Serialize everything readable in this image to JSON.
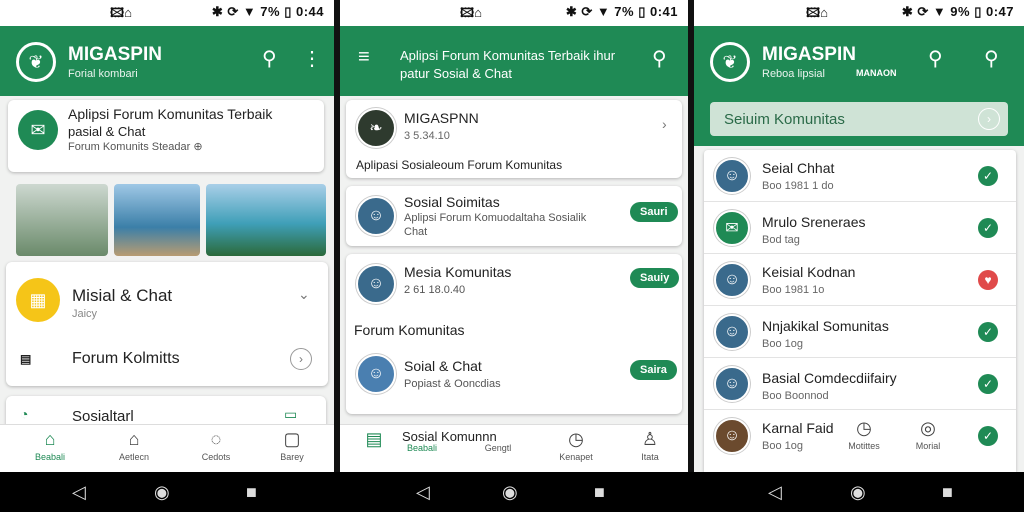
{
  "panel1": {
    "status_left": "🖾⌂",
    "status_right": "✱ ⟳ ▼ 7% ▯ 0:44",
    "brand": "MIGASPIN",
    "brand_sub": "Forial kombari",
    "feature_title": "Aplipsi Forum Komunitas Terbaik",
    "feature_line2": "pasial & Chat",
    "feature_line3": "Forum Komunits Steadar ⊕",
    "item1_title": "Misial & Chat",
    "item1_sub": "Jaicy",
    "item2_title": "Forum Kolmitts",
    "item3_title": "Sosialtarl",
    "nav": [
      "Beabali",
      "Aetlecn",
      "Cedots",
      "Barey"
    ]
  },
  "panel2": {
    "status_left": "🖾⌂",
    "status_right": "✱ ⟳ ▼ 7% ▯ 0:41",
    "header": "Aplipsi Forum Komunitas Terbaik ihur",
    "header2": "patur Sosial & Chat",
    "card1_title": "MIGASPNN",
    "card1_sub": "3 5.34.10",
    "card1_desc": "Aplipasi Sosialeoum Forum Komunitas",
    "row1_title": "Sosial Soimitas",
    "row1_desc": "Aplipsi Forum Komuodaltaha Sosialik",
    "row1_desc2": "Chat",
    "row1_btn": "Sauri",
    "row2_title": "Mesia Komunitas",
    "row2_sub": "2 61 18.0.40",
    "row2_btn": "Sauiy",
    "section": "Forum Komunitas",
    "row3_title": "Soial & Chat",
    "row3_sub": "Popiast & Ooncdias",
    "row3_btn": "Saira",
    "nav_title": "Sosial Komunnn",
    "nav": [
      "Beabali",
      "Gengtl",
      "Kenapet",
      "Itata"
    ]
  },
  "panel3": {
    "status_left": "🖾⌂",
    "status_right": "✱ ⟳ ▼ 9% ▯ 0:47",
    "brand": "MIGASPIN",
    "brand_sub": "Reboa lipsial",
    "brand_tag": "MANAON",
    "search": "Seiuim Komunitas",
    "list": [
      {
        "title": "Seial Chhat",
        "sub": "Boo 1981 1 do",
        "status": "ok"
      },
      {
        "title": "Mrulo Sreneraes",
        "sub": "Bod tag",
        "status": "ok"
      },
      {
        "title": "Keisial Kodnan",
        "sub": "Boo 1981 1o",
        "status": "heart"
      },
      {
        "title": "Nnjakikal Somunitas",
        "sub": "Boo 1og",
        "status": "ok"
      },
      {
        "title": "Basial Comdecdiifairy",
        "sub": "Boo Boonnod",
        "status": "ok"
      },
      {
        "title": "Karnal Faid",
        "sub": "Boo 1og",
        "status": "ok"
      }
    ],
    "nav": [
      "Motittes",
      "Morial"
    ]
  },
  "colors": {
    "accent": "#1f8a55",
    "heart": "#e04a4a"
  }
}
